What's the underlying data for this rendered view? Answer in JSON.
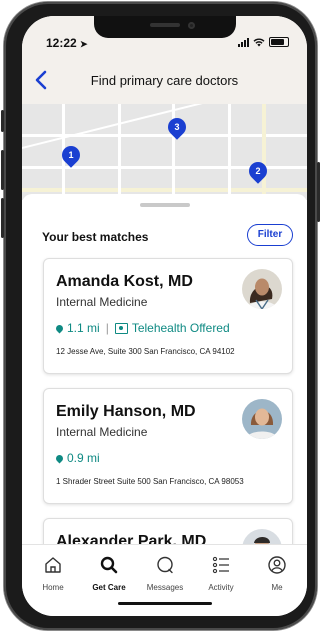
{
  "status": {
    "time": "12:22"
  },
  "header": {
    "title": "Find primary care doctors",
    "back_icon": "chevron-left-icon"
  },
  "map": {
    "pins": [
      "1",
      "2",
      "3"
    ],
    "accent": "#1a3fd1"
  },
  "results": {
    "section_title": "Your best matches",
    "filter_label": "Filter",
    "doctors": [
      {
        "name": "Amanda Kost, MD",
        "specialty": "Internal Medicine",
        "distance": "1.1 mi",
        "telehealth": "Telehealth Offered",
        "address": "12 Jesse Ave, Suite 300  San Francisco, CA 94102"
      },
      {
        "name": "Emily Hanson, MD",
        "specialty": "Internal Medicine",
        "distance": "0.9 mi",
        "address": "1 Shrader Street Suite 500  San Francisco, CA 98053"
      },
      {
        "name": "Alexander Park, MD"
      }
    ]
  },
  "tabs": [
    {
      "label": "Home",
      "icon": "home-icon"
    },
    {
      "label": "Get Care",
      "icon": "search-icon",
      "active": true
    },
    {
      "label": "Messages",
      "icon": "chat-icon"
    },
    {
      "label": "Activity",
      "icon": "list-icon"
    },
    {
      "label": "Me",
      "icon": "profile-icon"
    }
  ],
  "colors": {
    "accent": "#1a3fd1",
    "teal": "#0f8a83",
    "header_bg": "#f3f0ec"
  }
}
